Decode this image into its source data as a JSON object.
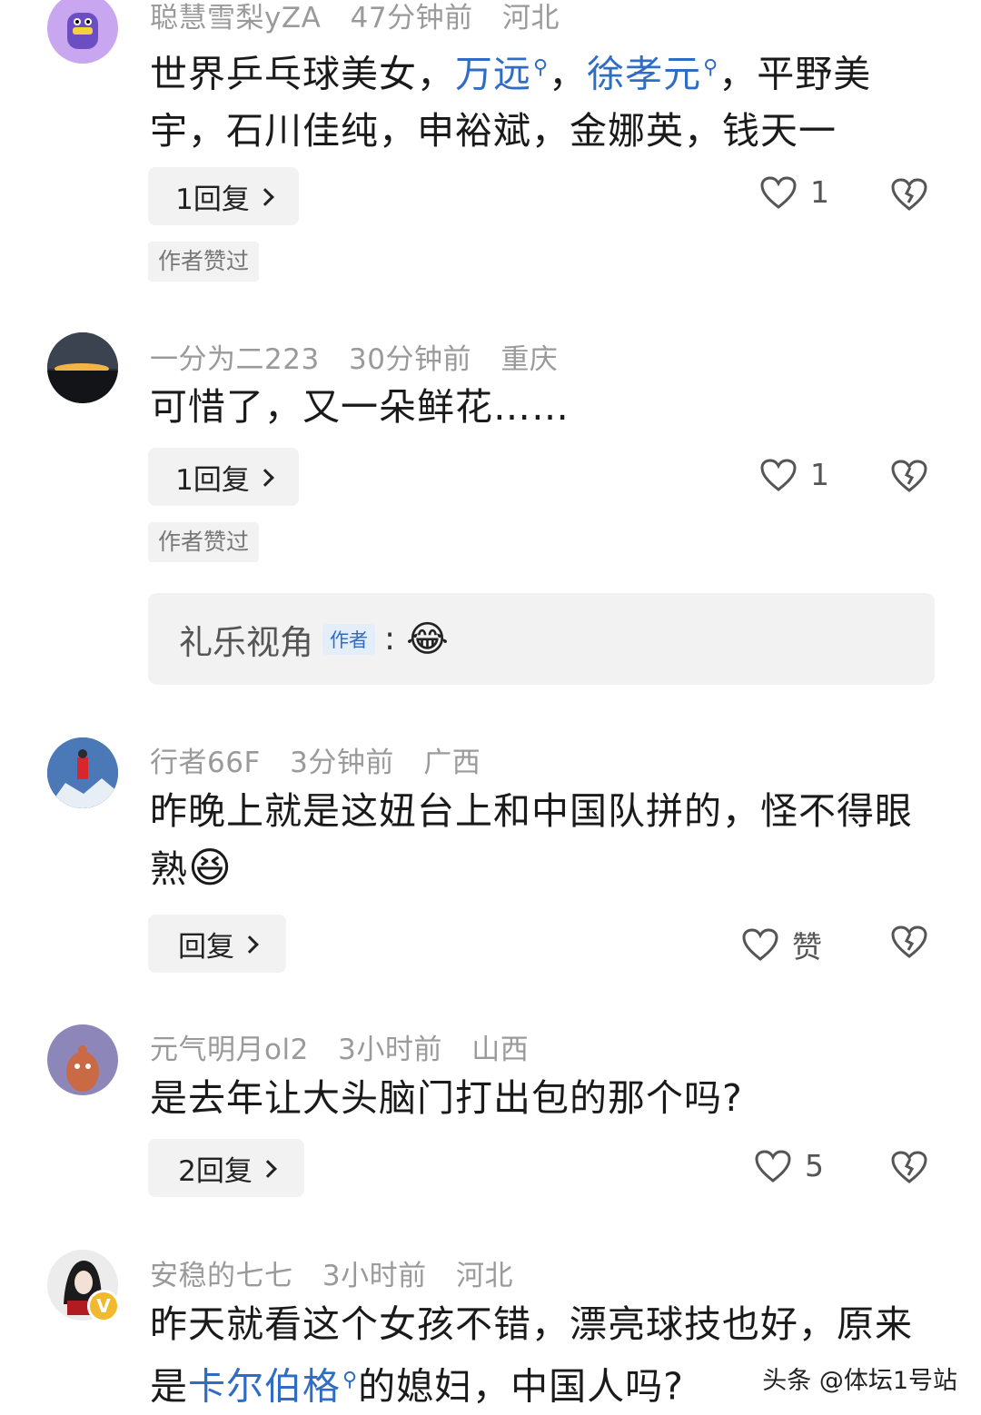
{
  "comments": [
    {
      "user": "聪慧雪梨yZA",
      "time": "47分钟前",
      "location": "河北",
      "text_parts": [
        "世界乒乓球美女，",
        "万远",
        "，",
        "徐孝元",
        "，平野美宇，石川佳纯，申裕斌，金娜英，钱天一"
      ],
      "reply_label": "1回复",
      "likes": "1",
      "badge": "作者赞过"
    },
    {
      "user": "一分为二223",
      "time": "30分钟前",
      "location": "重庆",
      "text": "可惜了，又一朵鲜花……",
      "reply_label": "1回复",
      "likes": "1",
      "badge": "作者赞过",
      "author_reply": {
        "name": "礼乐视角",
        "tag": "作者",
        "colon": ":",
        "emoji": "😂"
      }
    },
    {
      "user": "行者66F",
      "time": "3分钟前",
      "location": "广西",
      "text": "昨晚上就是这妞台上和中国队拼的，怪不得眼熟",
      "emoji": "😆",
      "reply_label": "回复",
      "likes": "赞"
    },
    {
      "user": "元气明月ol2",
      "time": "3小时前",
      "location": "山西",
      "text": "是去年让大头脑门打出包的那个吗?",
      "reply_label": "2回复",
      "likes": "5"
    },
    {
      "user": "安稳的七七",
      "time": "3小时前",
      "location": "河北",
      "text_parts": [
        "昨天就看这个女孩不错，漂亮球技也好，原来是",
        "卡尔伯格",
        "的媳妇，中国人吗?"
      ],
      "avatar_badge": "V"
    }
  ],
  "watermark": "头条 @体坛1号站",
  "colors": {
    "link": "#2f6dc4",
    "meta": "#9a9a9a",
    "button_bg": "#f2f2f2"
  }
}
